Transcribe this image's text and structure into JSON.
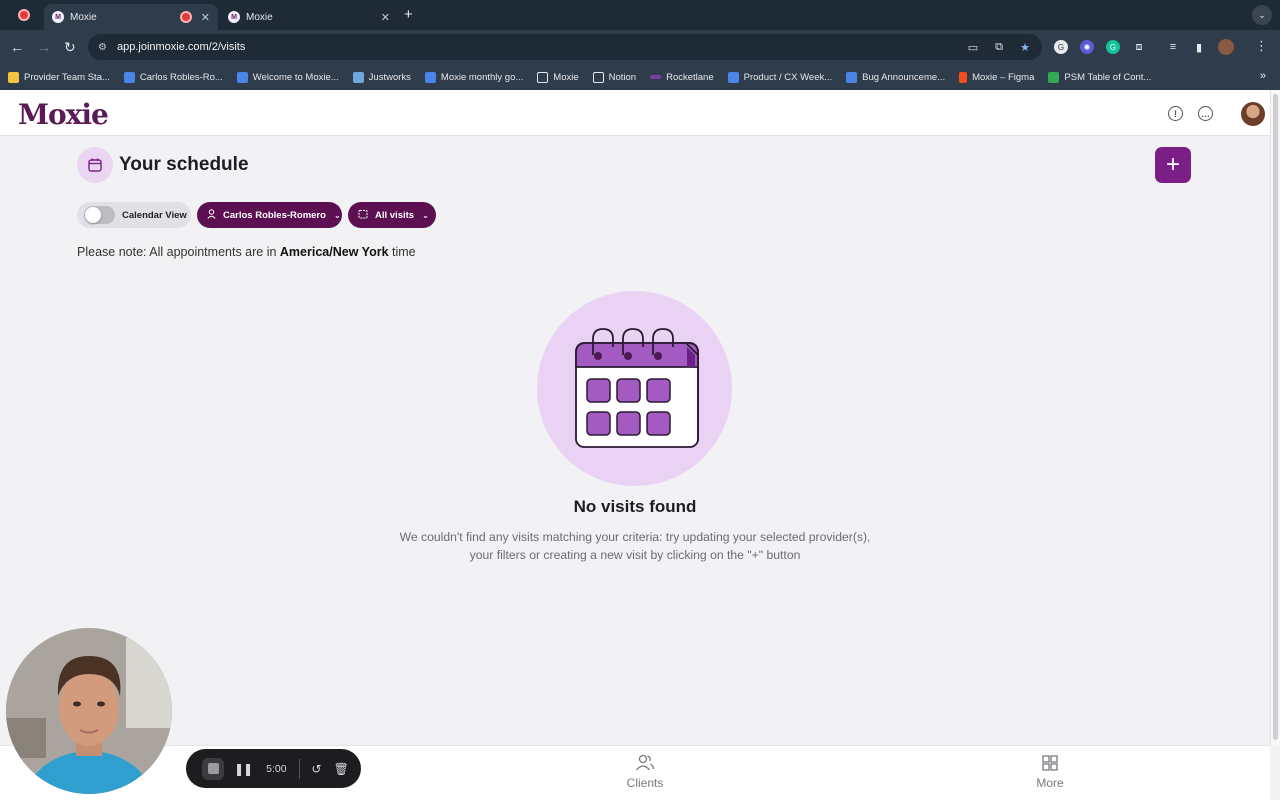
{
  "browser": {
    "tabs": [
      {
        "title": "Moxie",
        "active": true
      },
      {
        "title": "Moxie",
        "active": false
      }
    ],
    "url": "app.joinmoxie.com/2/visits",
    "bookmarks": [
      {
        "label": "Provider Team Sta...",
        "color": "#f5c542"
      },
      {
        "label": "Carlos Robles-Ro...",
        "color": "#4a86e8"
      },
      {
        "label": "Welcome to Moxie...",
        "color": "#4a86e8"
      },
      {
        "label": "Justworks",
        "color": "#6fa8dc"
      },
      {
        "label": "Moxie monthly go...",
        "color": "#4a86e8"
      },
      {
        "label": "Moxie",
        "color": "folder"
      },
      {
        "label": "Notion",
        "color": "folder"
      },
      {
        "label": "Rocketlane",
        "color": "#7b3fa0"
      },
      {
        "label": "Product / CX Week...",
        "color": "#4a86e8"
      },
      {
        "label": "Bug Announceme...",
        "color": "#4a86e8"
      },
      {
        "label": "Moxie – Figma",
        "color": "#f24e1e"
      },
      {
        "label": "PSM Table of Cont...",
        "color": "#34a853"
      }
    ]
  },
  "app": {
    "logo": "Moxie",
    "page_title": "Your schedule",
    "add_button": "+",
    "calendar_toggle_label": "Calendar View",
    "provider_filter": "Carlos Robles-Romero",
    "visits_filter": "All visits",
    "note_prefix": "Please note: All appointments are in ",
    "note_timezone": "America/New York",
    "note_suffix": " time",
    "empty_title": "No visits found",
    "empty_desc_line1": "We couldn't find any visits matching your criteria: try updating your selected provider(s),",
    "empty_desc_line2": "your filters or creating a new visit by clicking on the \"+\" button",
    "accent_color": "#7b1f86"
  },
  "bottom_nav": {
    "clients": "Clients",
    "more": "More"
  },
  "recorder": {
    "time": "5:00"
  }
}
